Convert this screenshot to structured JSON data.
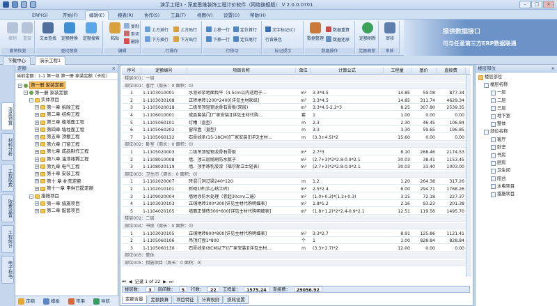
{
  "titlebar": {
    "title": "演示工程1 - 深度思维装饰工程计价软件（网络旗舰版） V 2.0.0.0701",
    "qa_items": [
      "保存",
      "撤销",
      "恢复",
      "↓"
    ]
  },
  "menu": {
    "tabs": [
      "ERP(G)",
      "开始(F)",
      "编辑(E)",
      "报表(R)",
      "协作(S)",
      "工具(T)",
      "视图(V)",
      "设置(O)",
      "帮助(H)"
    ],
    "active": 2
  },
  "ribbon": {
    "groups": [
      {
        "label": "撤销恢复",
        "big": [
          "撤销",
          "重做"
        ]
      },
      {
        "label": "查找替换",
        "big": [
          "文本查找",
          "定额替换",
          "定额搜索"
        ]
      },
      {
        "label": "编辑",
        "big": [
          "粘贴"
        ],
        "small": [
          "复制",
          "剪切",
          "删除"
        ]
      },
      {
        "label": "行操作",
        "small": [
          "上方插行",
          "下方插行",
          "上方贴行",
          "下方贴行"
        ]
      },
      {
        "label": "行移动",
        "small": [
          "上移一行",
          "下移一行",
          "定位首行",
          "定位尾行"
        ]
      },
      {
        "label": "标记提示",
        "small": [
          "文字标记(C)",
          "行背景色"
        ]
      },
      {
        "label": "数据操作",
        "big": [
          "数据整理"
        ],
        "small": [
          "数据重算",
          "数据还原"
        ]
      },
      {
        "label": "定额刷新",
        "big": [
          "定额刷新"
        ]
      },
      {
        "label": "审核",
        "big": [
          "审核"
        ]
      }
    ],
    "promo": [
      "提供数据接口",
      "可与任意第三方ERP数据联通"
    ]
  },
  "doctabs": [
    "下载中心",
    "演示工程1"
  ],
  "vtabs": [
    "清单预算",
    "材料分析",
    "工程取费",
    "取费设置",
    "工程统计",
    "电子标书"
  ],
  "left": {
    "title": "定额",
    "current": "当前定额：1-1 第一部 第一册 家装定额（卡批）",
    "tree": [
      {
        "t": "第一册 家装定额",
        "d": 0,
        "sel": true
      },
      {
        "t": "第一册 家装定额",
        "d": 1
      },
      {
        "t": "实体项目",
        "d": 2
      },
      {
        "t": "第一章 拆除工程",
        "d": 3
      },
      {
        "t": "第二章 结构工程",
        "d": 3
      },
      {
        "t": "第三章 楼地面工程",
        "d": 3
      },
      {
        "t": "第四章 墙柱面工程",
        "d": 3
      },
      {
        "t": "第五章 顶棚工程",
        "d": 3
      },
      {
        "t": "第六章 门窗工程",
        "d": 3
      },
      {
        "t": "第七章 成品制作工程",
        "d": 3
      },
      {
        "t": "第八章 油漆裱糊工程",
        "d": 3
      },
      {
        "t": "第九章 电气工程",
        "d": 3
      },
      {
        "t": "第十章 安装工程",
        "d": 3
      },
      {
        "t": "第十 章 补充定额",
        "d": 3
      },
      {
        "t": "第十一章 甲供已提定额",
        "d": 3
      },
      {
        "t": "措施项目",
        "d": 2
      },
      {
        "t": "第一章 措施项目",
        "d": 3
      },
      {
        "t": "第二章 配套项目",
        "d": 3
      }
    ],
    "bottom": [
      "定额",
      "模板",
      "常用",
      "导航"
    ]
  },
  "grid": {
    "headers": [
      "序号",
      "定额编号",
      "项目名称",
      "单位",
      "计算公式",
      "工程量",
      "基价",
      "直接费"
    ],
    "rows": [
      {
        "k": "grp",
        "name": "楼层001：一层"
      },
      {
        "k": "grp",
        "name": "部位001：客厅（周长：0 面积：0）"
      },
      {
        "k": "d",
        "no": "1",
        "code": "1-1103010001",
        "name": "水泥砂浆地面找平（4.5cm以内适用于...",
        "unit": "m²",
        "formula": "3.3*4.5",
        "qty": "14.85",
        "price": "59.08",
        "cost": "877.34"
      },
      {
        "k": "d",
        "no": "2",
        "code": "1-1103030108",
        "name": "正砖地砖1200*2400[详见主材家纸]",
        "unit": "m²",
        "formula": "3.3*4.5",
        "qty": "14.85",
        "price": "311.74",
        "cost": "4629.34"
      },
      {
        "k": "d",
        "no": "3",
        "code": "1-1105020018",
        "name": "二级吊顶轻钢龙骨石膏板(双层)",
        "unit": "m²",
        "formula": "3.3*4.5-2.2*3",
        "qty": "8.25",
        "price": "307.80",
        "cost": "2539.35"
      },
      {
        "k": "d",
        "no": "4",
        "code": "1-1106010001",
        "name": "成品套装门[厂家安装][详见主材代购...",
        "unit": "套",
        "formula": "1",
        "qty": "1.00",
        "price": "0.00",
        "cost": "0.00"
      },
      {
        "k": "d",
        "no": "5",
        "code": "1-1105060101",
        "name": "灯槽（直型）",
        "unit": "m",
        "formula": "2.3",
        "qty": "2.30",
        "price": "46.45",
        "cost": "106.84"
      },
      {
        "k": "d",
        "no": "6",
        "code": "1-1105060202",
        "name": "窗帘盒（直型）",
        "unit": "m",
        "formula": "3.3",
        "qty": "3.30",
        "price": "59.65",
        "cost": "196.85"
      },
      {
        "k": "d",
        "no": "7",
        "code": "1-1105060132",
        "name": "石膏线条(15-18CM)[厂家安装][详见主材...",
        "unit": "m",
        "formula": "(3.3+4.5)*2",
        "qty": "15.60",
        "price": "0.00",
        "cost": "0.00"
      },
      {
        "k": "grp",
        "name": "部位002：卧室（周长：0 面积：0）"
      },
      {
        "k": "d",
        "no": "1",
        "code": "1-1105020003",
        "name": "二级吊顶轻钢龙骨石膏板",
        "unit": "m²",
        "formula": "2.7*3",
        "qty": "8.10",
        "price": "268.46",
        "cost": "2174.53"
      },
      {
        "k": "d",
        "no": "2",
        "code": "1-1108010008",
        "name": "墙、顶三层抛刷防水腻子",
        "unit": "m²",
        "formula": "(2.7+3)*2*2.8-0.9*2.1",
        "qty": "30.03",
        "price": "38.41",
        "cost": "1153.45"
      },
      {
        "k": "d",
        "no": "3",
        "code": "1-1108020119",
        "name": "墙、顶手琢乳胶漆（福尔斯立士轻表）",
        "unit": "m²",
        "formula": "(2.7+3)*2*2.8-0.9*2.1",
        "qty": "30.03",
        "price": "33.40",
        "cost": "1003.00"
      },
      {
        "k": "grp",
        "name": "部位003：卫生间（周长：0 面积：0）"
      },
      {
        "k": "d",
        "no": "1",
        "code": "1-1102020007",
        "name": "砖混门洞过梁240*120",
        "unit": "m",
        "formula": "1.2",
        "qty": "1.20",
        "price": "264.38",
        "cost": "317.26"
      },
      {
        "k": "d",
        "no": "2",
        "code": "1-1102010101",
        "name": "新砌1砖(实心粘土砖)",
        "unit": "m²",
        "formula": "2.5*2.4",
        "qty": "6.00",
        "price": "294.71",
        "cost": "1768.26"
      },
      {
        "k": "d",
        "no": "3",
        "code": "1-1109020004",
        "name": "墙地涂防水处理（卷起30cm/二遍）",
        "unit": "m²",
        "formula": "(1.0+0.3)*(1.2+0.3)",
        "qty": "3.15",
        "price": "72.18",
        "cost": "227.37"
      },
      {
        "k": "d",
        "no": "4",
        "code": "1-1103030103",
        "name": "正铺地砖300*300[详见主材代购明细表]",
        "unit": "m²",
        "formula": "1.8*1.2",
        "qty": "2.16",
        "price": "93.23",
        "cost": "201.38"
      },
      {
        "k": "d",
        "no": "5",
        "code": "1-1104020105",
        "name": "墙面正铺砖300*600[详见主材代购明细表]",
        "unit": "m²",
        "formula": "(1.8+1.2)*2*2.4-0.9*2.1",
        "qty": "12.51",
        "price": "119.56",
        "cost": "1495.70"
      },
      {
        "k": "grp",
        "name": "楼层002：二层"
      },
      {
        "k": "grp",
        "name": "部位004：书房（周长：0 面积：0）"
      },
      {
        "k": "d",
        "no": "1",
        "code": "1-1103030105",
        "name": "正铺地砖800*800[详见主材代购明细表]",
        "unit": "m²",
        "formula": "3.3*2.7",
        "qty": "8.91",
        "price": "125.86",
        "cost": "1121.41"
      },
      {
        "k": "d",
        "no": "2",
        "code": "1-1105060106",
        "name": "吊顶灯盘1*800",
        "unit": "个",
        "formula": "1",
        "qty": "1.00",
        "price": "828.84",
        "cost": "828.84"
      },
      {
        "k": "d",
        "no": "3",
        "code": "1-1105060130",
        "name": "石膏线条(8CM以下)[厂家安装][详见主材...",
        "unit": "m",
        "formula": "(3.3+2.7)*2",
        "qty": "12.00",
        "price": "0.00",
        "cost": "0.00"
      },
      {
        "k": "grp",
        "name": "部位005：整体"
      },
      {
        "k": "grp",
        "name": "部位005：措施项目（周长：0 面积：0）"
      }
    ],
    "nav": "记录 1 of 22",
    "status": {
      "floor_l": "楼层数：",
      "floor": "3",
      "room_l": "房间数：",
      "room": "5",
      "rows_l": "行数：",
      "rows": "22",
      "qty_l": "工程量：",
      "qty": "1575.24",
      "cost_l": "直接费：",
      "cost": "29056.92"
    },
    "bottom_tabs": [
      "定额含量",
      "定额换算",
      "项目特征",
      "计算规则",
      "损耗设置"
    ]
  },
  "right": {
    "title": "楼层部位",
    "root": "楼层部位",
    "floors_label": "楼层名称",
    "floors": [
      "一层",
      "二层",
      "三层",
      "地下室",
      "整体"
    ],
    "parts_label": "部位名称",
    "parts": [
      "客厅",
      "卧室",
      "书房",
      "厨房",
      "卫生间",
      "阳台",
      "水电项目",
      "措施项目"
    ]
  },
  "colors": {
    "accent": "#2c5aa0",
    "selected": "#f7c064",
    "ribbon_bg": "#d3e2f4"
  }
}
